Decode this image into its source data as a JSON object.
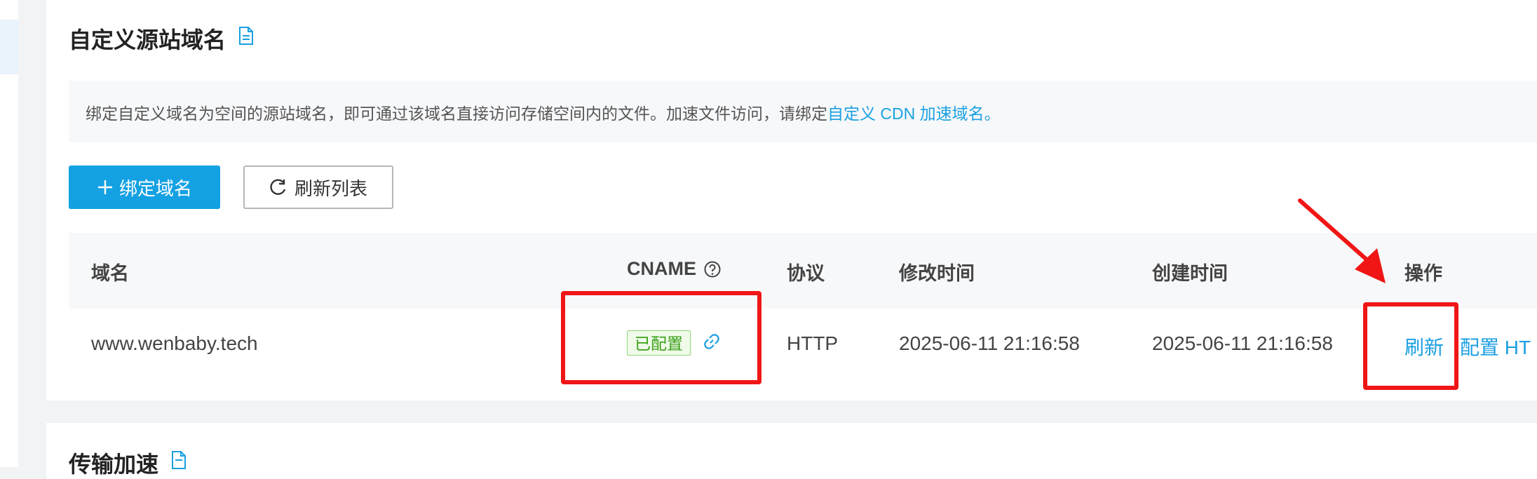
{
  "sections": {
    "custom_domain_title": "自定义源站域名",
    "transfer_accel_title": "传输加速"
  },
  "notice": {
    "text": "绑定自定义域名为空间的源站域名，即可通过该域名直接访问存储空间内的文件。加速文件访问，请绑定",
    "link": "自定义 CDN 加速域名。"
  },
  "toolbar": {
    "bind_domain_label": "绑定域名",
    "refresh_list_label": "刷新列表"
  },
  "table": {
    "headers": {
      "domain": "域名",
      "cname": "CNAME",
      "protocol": "协议",
      "modified": "修改时间",
      "created": "创建时间",
      "actions": "操作"
    },
    "rows": [
      {
        "domain": "www.wenbaby.tech",
        "cname_status": "已配置",
        "protocol": "HTTP",
        "modified": "2025-06-11 21:16:58",
        "created": "2025-06-11 21:16:58",
        "actions": [
          "刷新",
          "配置 HT"
        ]
      }
    ]
  },
  "colors": {
    "primary": "#14a1e3",
    "link": "#1a9fe0",
    "success": "#3aa018",
    "annotation": "#f01616"
  },
  "icons": [
    "plus-icon",
    "refresh-icon",
    "help-circle-icon",
    "link-icon",
    "document-icon"
  ]
}
